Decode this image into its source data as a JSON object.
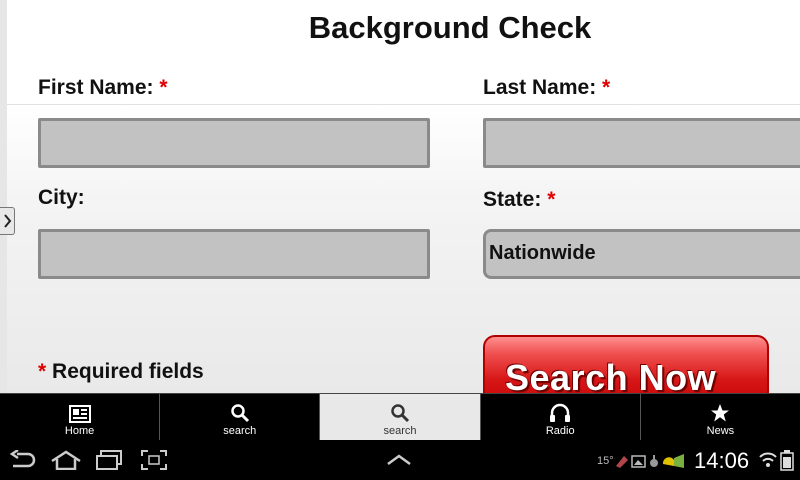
{
  "page": {
    "title": "Background Check",
    "required_mark": "*"
  },
  "form": {
    "first_name_label": "First Name:",
    "last_name_label": "Last Name:",
    "city_label": "City:",
    "state_label": "State:",
    "state_value": "Nationwide",
    "required_note": "Required fields",
    "search_button": "Search Now"
  },
  "tabs": [
    {
      "label": "Home",
      "icon": "home-card-icon"
    },
    {
      "label": "search",
      "icon": "search-icon"
    },
    {
      "label": "search",
      "icon": "search-icon",
      "active": true
    },
    {
      "label": "Radio",
      "icon": "headphones-icon"
    },
    {
      "label": "News",
      "icon": "star-icon"
    }
  ],
  "system_bar": {
    "time": "14:06",
    "temperature": "15°"
  },
  "colors": {
    "required": "#e00000",
    "field_fill": "#c2c2c2",
    "button_red": "#d81818"
  }
}
